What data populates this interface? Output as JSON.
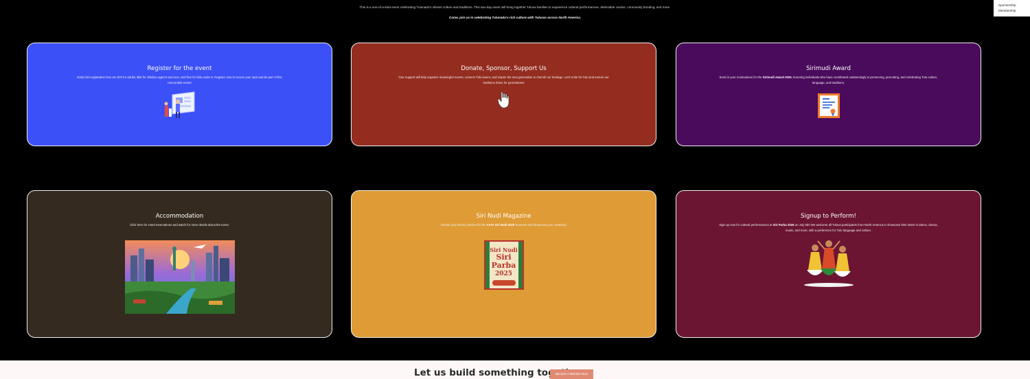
{
  "intro": {
    "line1": "This is a one-of-a-kind event celebrating Tulunadu's vibrant culture and traditions. This two-day event will bring together Tuluva families to experience cultural performances, delectable cuisine, community bonding, and more.",
    "line2": "Come, join us in celebrating Tulunadu's rich culture with Tuluvas across North America."
  },
  "dropdown": {
    "items": [
      "Sponsorship",
      "Membership"
    ]
  },
  "cards": [
    {
      "title": "Register for the event",
      "text": "Early bird registration fees are $75 for adults, $50 for children aged 6 and over, and free for kids under 6. Register now to secure your spot and be part of this memorable event!",
      "icon": "registration-illustration",
      "color": "#3c50f7"
    },
    {
      "title": "Donate, Sponsor, Support Us",
      "text": "Your support will help organize meaningful events, connect Tulu lovers, and inspire the next generation to cherish our heritage. Let's unite for Tulu and ensure our traditions thrive for generations!",
      "icon": "hand-icon",
      "color": "#942d20"
    },
    {
      "title": "Sirimudi Award",
      "text_pre": "Send in your nominations for the ",
      "text_bold": "Sirimudi Award 2025",
      "text_post": ", honoring individuals who have contributed outstandingly to preserving, promoting, and celebrating Tulu culture, language, and traditions.",
      "icon": "certificate-icon",
      "color": "#4a0b5c"
    },
    {
      "title": "Accommodation",
      "text": "Click here for Hotel reservations and watch for more details about the event.",
      "icon": "city-collage-image",
      "color": "#352a20"
    },
    {
      "title": "Siri Nudi Magazine",
      "text_pre": "Submit your literary articles for the ",
      "text_bold": "AATA Siri Nudi 2025",
      "text_post": " Souvenir and showcase your creativity!",
      "icon": "magazine-cover-image",
      "magazine_line1": "Siri Nudi",
      "magazine_line2": "Siri",
      "magazine_line3": "Parba",
      "magazine_year": "2025",
      "color": "#df9b35"
    },
    {
      "title": "Signup to Perform!",
      "text_pre": "Sign up now for cultural performances at ",
      "text_bold": "Siri Parba 2025",
      "text_post": " on July 5th! We welcome all Tuluva participants from North America to showcase their talent in dance, drama, music, and more, with a preference for Tulu language and culture.",
      "icon": "dancers-illustration",
      "color": "#6b1533"
    }
  ],
  "footer": {
    "heading": "Let us build something together",
    "cta_label": "Become A Member Now"
  }
}
